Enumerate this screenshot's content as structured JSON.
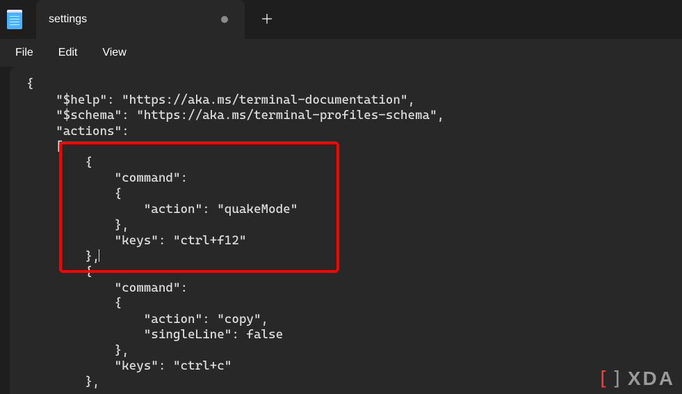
{
  "tab": {
    "title": "settings"
  },
  "menu": {
    "file": "File",
    "edit": "Edit",
    "view": "View"
  },
  "code": {
    "l1": "{",
    "l2": "    \"$help\": \"https://aka.ms/terminal-documentation\",",
    "l3": "    \"$schema\": \"https://aka.ms/terminal-profiles-schema\",",
    "l4": "    \"actions\":",
    "l5": "    [",
    "l6": "        {",
    "l7": "            \"command\":",
    "l8": "            {",
    "l9": "                \"action\": \"quakeMode\"",
    "l10": "            },",
    "l11": "            \"keys\": \"ctrl+f12\"",
    "l12": "        },",
    "l13": "        {",
    "l14": "            \"command\":",
    "l15": "            {",
    "l16": "                \"action\": \"copy\",",
    "l17": "                \"singleLine\": false",
    "l18": "            },",
    "l19": "            \"keys\": \"ctrl+c\"",
    "l20": "        },"
  },
  "watermark": {
    "text": "XDA"
  }
}
